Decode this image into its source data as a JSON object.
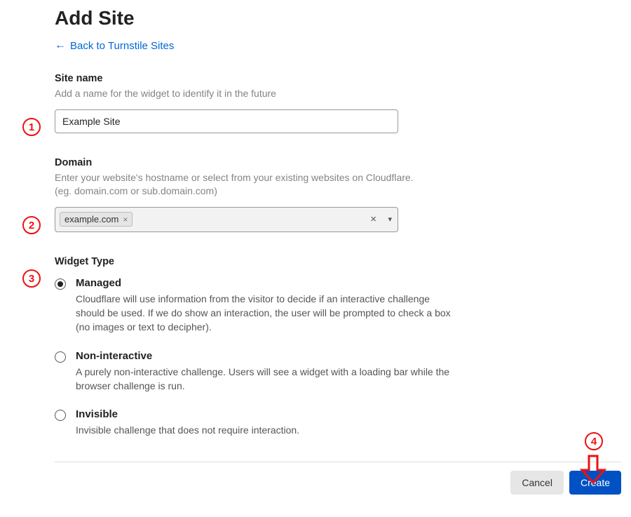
{
  "page": {
    "title": "Add Site",
    "back_link": "Back to Turnstile Sites"
  },
  "site_name": {
    "label": "Site name",
    "hint": "Add a name for the widget to identify it in the future",
    "value": "Example Site"
  },
  "domain": {
    "label": "Domain",
    "hint": "Enter your website's hostname or select from your existing websites on Cloudflare. (eg. domain.com or sub.domain.com)",
    "chip": "example.com"
  },
  "widget_type": {
    "label": "Widget Type",
    "options": [
      {
        "title": "Managed",
        "desc": "Cloudflare will use information from the visitor to decide if an interactive challenge should be used. If we do show an interaction, the user will be prompted to check a box (no images or text to decipher).",
        "checked": true
      },
      {
        "title": "Non-interactive",
        "desc": "A purely non-interactive challenge. Users will see a widget with a loading bar while the browser challenge is run.",
        "checked": false
      },
      {
        "title": "Invisible",
        "desc": "Invisible challenge that does not require interaction.",
        "checked": false
      }
    ]
  },
  "footer": {
    "cancel": "Cancel",
    "create": "Create"
  },
  "annotations": {
    "step1": "1",
    "step2": "2",
    "step3": "3",
    "step4": "4"
  }
}
